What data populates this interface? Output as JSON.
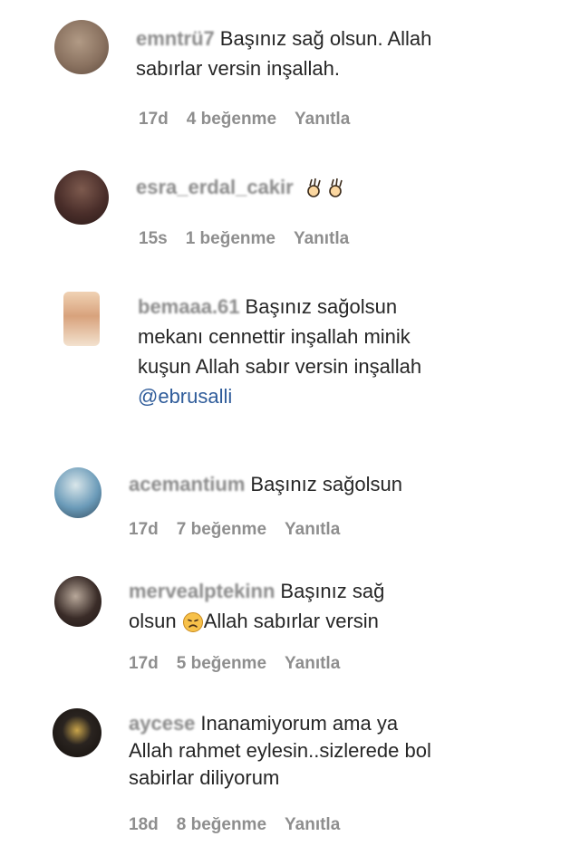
{
  "comments": [
    {
      "username": "emntrü7",
      "text": "Başınız sağ olsun. Allah sabırlar versin inşallah.",
      "time": "17d",
      "likes": "4 beğenme",
      "reply": "Yanıtla",
      "avatar_color": "#8a7260"
    },
    {
      "username": "esra_erdal_cakir",
      "text": "",
      "emoji": "ok-hand-icon",
      "time": "15s",
      "likes": "1 beğenme",
      "reply": "Yanıtla",
      "avatar_color": "#4a2e2a"
    },
    {
      "username": "bemaaa.61",
      "line1": "Başınız sağolsun",
      "line2": "mekanı cennettir inşallah minik",
      "line3": "kuşun Allah sabır versin inşallah",
      "mention": "@ebrusalli",
      "avatar_color": "#d8a27c"
    },
    {
      "username": "acemantium",
      "text": "Başınız sağolsun",
      "time": "17d",
      "likes": "7 beğenme",
      "reply": "Yanıtla",
      "avatar_color": "#6a9ab8"
    },
    {
      "username": "mervealptekinn",
      "part1": "Başınız sağ",
      "part2": "olsun",
      "part3": "Allah sabırlar versin",
      "time": "17d",
      "likes": "5 beğenme",
      "reply": "Yanıtla",
      "avatar_color": "#3a2c28"
    },
    {
      "username": "aycese",
      "line1": "Inanamiyorum ama ya",
      "line2": "Allah rahmet eylesin..sizlerede bol",
      "line3": "sabirlar diliyorum",
      "time": "18d",
      "likes": "8 beğenme",
      "reply": "Yanıtla",
      "avatar_color": "#2a2420"
    }
  ]
}
